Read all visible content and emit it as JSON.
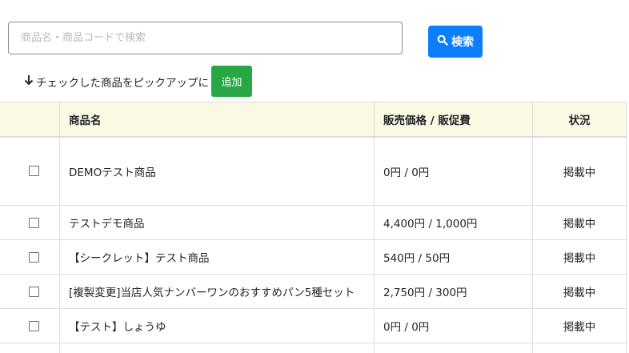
{
  "search": {
    "placeholder": "商品名・商品コードで検索",
    "button_label": "検索"
  },
  "pickup": {
    "label": "チェックした商品をピックアップに",
    "add_label": "追加"
  },
  "table": {
    "headers": {
      "name": "商品名",
      "price": "販売価格 / 販促費",
      "status": "状況"
    },
    "rows": [
      {
        "name": "DEMOテスト商品",
        "price": "0円 / 0円",
        "status": "掲載中"
      },
      {
        "name": "テストデモ商品",
        "price": "4,400円 / 1,000円",
        "status": "掲載中"
      },
      {
        "name": "【シークレット】テスト商品",
        "price": "540円 / 50円",
        "status": "掲載中"
      },
      {
        "name": "[複製変更]当店人気ナンバーワンのおすすめパン5種セット",
        "price": "2,750円 / 300円",
        "status": "掲載中"
      },
      {
        "name": "【テスト】しょうゆ",
        "price": "0円 / 0円",
        "status": "掲載中"
      }
    ]
  },
  "colors": {
    "primary": "#0d7ef7",
    "success": "#28a745",
    "header_bg": "#f9f9e4"
  },
  "icons": {
    "search": "search-icon",
    "arrow": "arrow-down-icon"
  }
}
